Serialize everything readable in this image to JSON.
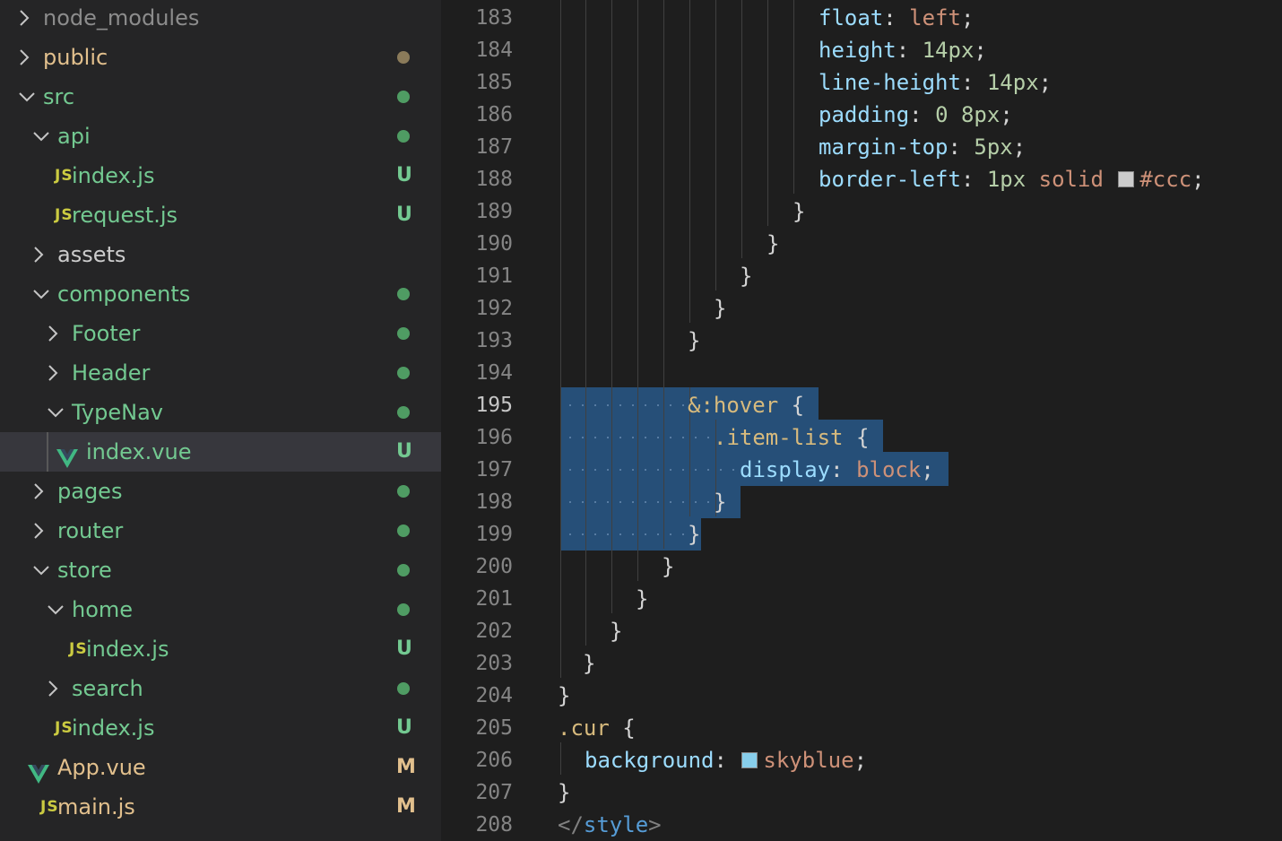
{
  "explorer": {
    "items": [
      {
        "label": "node_modules",
        "depth": 0,
        "kind": "folder",
        "expanded": false,
        "color": "#8c8c8c",
        "status": ""
      },
      {
        "label": "public",
        "depth": 0,
        "kind": "folder",
        "expanded": false,
        "color": "#e2c08d",
        "status": "dot",
        "status_color": "#8b7b5a"
      },
      {
        "label": "src",
        "depth": 0,
        "kind": "folder",
        "expanded": true,
        "color": "#73c991",
        "status": "dot",
        "status_color": "#4f9c63"
      },
      {
        "label": "api",
        "depth": 1,
        "kind": "folder",
        "expanded": true,
        "color": "#73c991",
        "status": "dot",
        "status_color": "#4f9c63"
      },
      {
        "label": "index.js",
        "depth": 1,
        "kind": "js",
        "color": "#73c991",
        "status": "U",
        "status_color": "#73c991"
      },
      {
        "label": "request.js",
        "depth": 1,
        "kind": "js",
        "color": "#73c991",
        "status": "U",
        "status_color": "#73c991"
      },
      {
        "label": "assets",
        "depth": 1,
        "kind": "folder",
        "expanded": false,
        "color": "#cccccc",
        "status": ""
      },
      {
        "label": "components",
        "depth": 1,
        "kind": "folder",
        "expanded": true,
        "color": "#73c991",
        "status": "dot",
        "status_color": "#4f9c63"
      },
      {
        "label": "Footer",
        "depth": 2,
        "kind": "folder",
        "expanded": false,
        "color": "#73c991",
        "status": "dot",
        "status_color": "#4f9c63"
      },
      {
        "label": "Header",
        "depth": 2,
        "kind": "folder",
        "expanded": false,
        "color": "#73c991",
        "status": "dot",
        "status_color": "#4f9c63"
      },
      {
        "label": "TypeNav",
        "depth": 2,
        "kind": "folder",
        "expanded": true,
        "color": "#73c991",
        "status": "dot",
        "status_color": "#4f9c63"
      },
      {
        "label": "index.vue",
        "depth": 2,
        "kind": "vue",
        "color": "#73c991",
        "status": "U",
        "status_color": "#73c991",
        "selected": true
      },
      {
        "label": "pages",
        "depth": 1,
        "kind": "folder",
        "expanded": false,
        "color": "#73c991",
        "status": "dot",
        "status_color": "#4f9c63"
      },
      {
        "label": "router",
        "depth": 1,
        "kind": "folder",
        "expanded": false,
        "color": "#73c991",
        "status": "dot",
        "status_color": "#4f9c63"
      },
      {
        "label": "store",
        "depth": 1,
        "kind": "folder",
        "expanded": true,
        "color": "#73c991",
        "status": "dot",
        "status_color": "#4f9c63"
      },
      {
        "label": "home",
        "depth": 2,
        "kind": "folder",
        "expanded": true,
        "color": "#73c991",
        "status": "dot",
        "status_color": "#4f9c63"
      },
      {
        "label": "index.js",
        "depth": 2,
        "kind": "js",
        "color": "#73c991",
        "status": "U",
        "status_color": "#73c991"
      },
      {
        "label": "search",
        "depth": 2,
        "kind": "folder",
        "expanded": false,
        "color": "#73c991",
        "status": "dot",
        "status_color": "#4f9c63"
      },
      {
        "label": "index.js",
        "depth": 1,
        "kind": "js",
        "color": "#73c991",
        "status": "U",
        "status_color": "#73c991"
      },
      {
        "label": "App.vue",
        "depth": 0,
        "kind": "vue",
        "color": "#e2c08d",
        "status": "M",
        "status_color": "#e2c08d"
      },
      {
        "label": "main.js",
        "depth": 0,
        "kind": "js",
        "color": "#e2c08d",
        "status": "M",
        "status_color": "#e2c08d"
      }
    ]
  },
  "editor": {
    "active_line": 195,
    "lines": [
      {
        "n": "183",
        "tokens": [
          [
            "float",
            "k-prop"
          ],
          [
            ": ",
            "k-punc"
          ],
          [
            "left",
            "k-val"
          ],
          [
            ";",
            "k-punc"
          ]
        ]
      },
      {
        "n": "184",
        "tokens": [
          [
            "height",
            "k-prop"
          ],
          [
            ": ",
            "k-punc"
          ],
          [
            "14px",
            "k-num"
          ],
          [
            ";",
            "k-punc"
          ]
        ]
      },
      {
        "n": "185",
        "tokens": [
          [
            "line-height",
            "k-prop"
          ],
          [
            ": ",
            "k-punc"
          ],
          [
            "14px",
            "k-num"
          ],
          [
            ";",
            "k-punc"
          ]
        ]
      },
      {
        "n": "186",
        "tokens": [
          [
            "padding",
            "k-prop"
          ],
          [
            ": ",
            "k-punc"
          ],
          [
            "0 8px",
            "k-num"
          ],
          [
            ";",
            "k-punc"
          ]
        ]
      },
      {
        "n": "187",
        "tokens": [
          [
            "margin-top",
            "k-prop"
          ],
          [
            ": ",
            "k-punc"
          ],
          [
            "5px",
            "k-num"
          ],
          [
            ";",
            "k-punc"
          ]
        ]
      },
      {
        "n": "188",
        "tokens": [
          [
            "border-left",
            "k-prop"
          ],
          [
            ": ",
            "k-punc"
          ],
          [
            "1px ",
            "k-num"
          ],
          [
            "solid ",
            "k-val"
          ],
          [
            "#ccc",
            "k-val"
          ],
          [
            ";",
            "k-punc"
          ]
        ],
        "swatch": "#cccccc"
      },
      {
        "n": "189",
        "tokens": [
          [
            "}",
            "k-punc"
          ]
        ]
      },
      {
        "n": "190",
        "tokens": [
          [
            "}",
            "k-punc"
          ]
        ]
      },
      {
        "n": "191",
        "tokens": [
          [
            "}",
            "k-punc"
          ]
        ]
      },
      {
        "n": "192",
        "tokens": [
          [
            "}",
            "k-punc"
          ]
        ]
      },
      {
        "n": "193",
        "tokens": [
          [
            "}",
            "k-punc"
          ]
        ]
      },
      {
        "n": "194",
        "tokens": []
      },
      {
        "n": "195",
        "tokens": [
          [
            "&:hover",
            "k-sel"
          ],
          [
            " {",
            "k-punc"
          ]
        ]
      },
      {
        "n": "196",
        "tokens": [
          [
            ".item-list",
            "k-sel"
          ],
          [
            " {",
            "k-punc"
          ]
        ]
      },
      {
        "n": "197",
        "tokens": [
          [
            "display",
            "k-prop"
          ],
          [
            ": ",
            "k-punc"
          ],
          [
            "block",
            "k-val"
          ],
          [
            ";",
            "k-punc"
          ]
        ]
      },
      {
        "n": "198",
        "tokens": [
          [
            "}",
            "k-punc"
          ]
        ]
      },
      {
        "n": "199",
        "tokens": [
          [
            "}",
            "k-punc"
          ]
        ]
      },
      {
        "n": "200",
        "tokens": [
          [
            "}",
            "k-punc"
          ]
        ]
      },
      {
        "n": "201",
        "tokens": [
          [
            "}",
            "k-punc"
          ]
        ]
      },
      {
        "n": "202",
        "tokens": [
          [
            "}",
            "k-punc"
          ]
        ]
      },
      {
        "n": "203",
        "tokens": [
          [
            "}",
            "k-punc"
          ]
        ]
      },
      {
        "n": "204",
        "tokens": [
          [
            "}",
            "k-punc"
          ]
        ]
      },
      {
        "n": "205",
        "tokens": [
          [
            ".cur",
            "k-sel"
          ],
          [
            " {",
            "k-punc"
          ]
        ]
      },
      {
        "n": "206",
        "tokens": [
          [
            "background",
            "k-prop"
          ],
          [
            ": ",
            "k-punc"
          ],
          [
            "skyblue",
            "k-val"
          ],
          [
            ";",
            "k-punc"
          ]
        ],
        "swatch": "#87ceeb"
      },
      {
        "n": "207",
        "tokens": [
          [
            "}",
            "k-punc"
          ]
        ]
      },
      {
        "n": "208",
        "tokens": [
          [
            "</",
            "k-bracket"
          ],
          [
            "style",
            "k-tag"
          ],
          [
            ">",
            "k-bracket"
          ]
        ]
      }
    ]
  }
}
